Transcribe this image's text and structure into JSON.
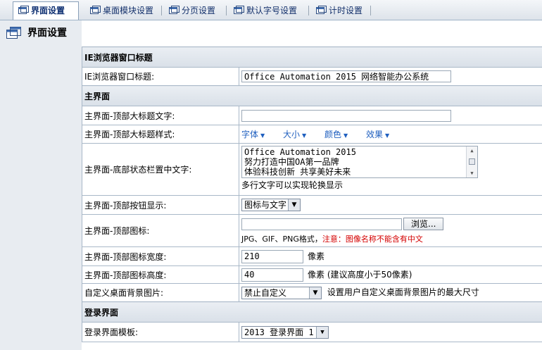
{
  "tabs": [
    {
      "label": "界面设置",
      "icon": "window-icon",
      "active": true
    },
    {
      "label": "桌面模块设置",
      "icon": "window-icon",
      "active": false
    },
    {
      "label": "分页设置",
      "icon": "window-icon",
      "active": false
    },
    {
      "label": "默认字号设置",
      "icon": "window-icon",
      "active": false
    },
    {
      "label": "计时设置",
      "icon": "window-icon",
      "active": false
    }
  ],
  "page": {
    "title": "界面设置",
    "icon": "window-icon"
  },
  "sections": {
    "ie": "IE浏览器窗口标题",
    "main": "主界面",
    "login": "登录界面"
  },
  "rows": {
    "ie_title": {
      "label": "IE浏览器窗口标题:",
      "value": "Office Automation 2015 网络智能办公系统"
    },
    "top_title_text": {
      "label": "主界面-顶部大标题文字:",
      "value": ""
    },
    "top_title_style": {
      "label": "主界面-顶部大标题样式:",
      "options": [
        "字体",
        "大小",
        "颜色",
        "效果"
      ]
    },
    "bottom_status": {
      "label": "主界面-底部状态栏置中文字:",
      "lines": [
        "Office Automation 2015",
        "努力打造中国OA第一品牌",
        "体验科技创新 共享美好未来"
      ],
      "hint": "多行文字可以实现轮换显示"
    },
    "top_button": {
      "label": "主界面-顶部按钮显示:",
      "selected": "图标与文字"
    },
    "top_icon": {
      "label": "主界面-顶部图标:",
      "value": "",
      "browse": "浏览...",
      "hint": "JPG、GIF、PNG格式，",
      "hint_warning": "注意：图像名称不能含有中文"
    },
    "icon_width": {
      "label": "主界面-顶部图标宽度:",
      "value": "210",
      "unit": "像素"
    },
    "icon_height": {
      "label": "主界面-顶部图标高度:",
      "value": "40",
      "unit": "像素 (建议高度小于50像素)"
    },
    "custom_bg": {
      "label": "自定义桌面背景图片:",
      "selected": "禁止自定义",
      "hint": "设置用户自定义桌面背景图片的最大尺寸"
    },
    "login_template": {
      "label": "登录界面模板:",
      "selected": "2013 登录界面 1"
    }
  },
  "colors": {
    "tab_text": "#13306b",
    "link": "#1f5fbf",
    "warning": "#d40000",
    "border": "#a9b8c8"
  }
}
